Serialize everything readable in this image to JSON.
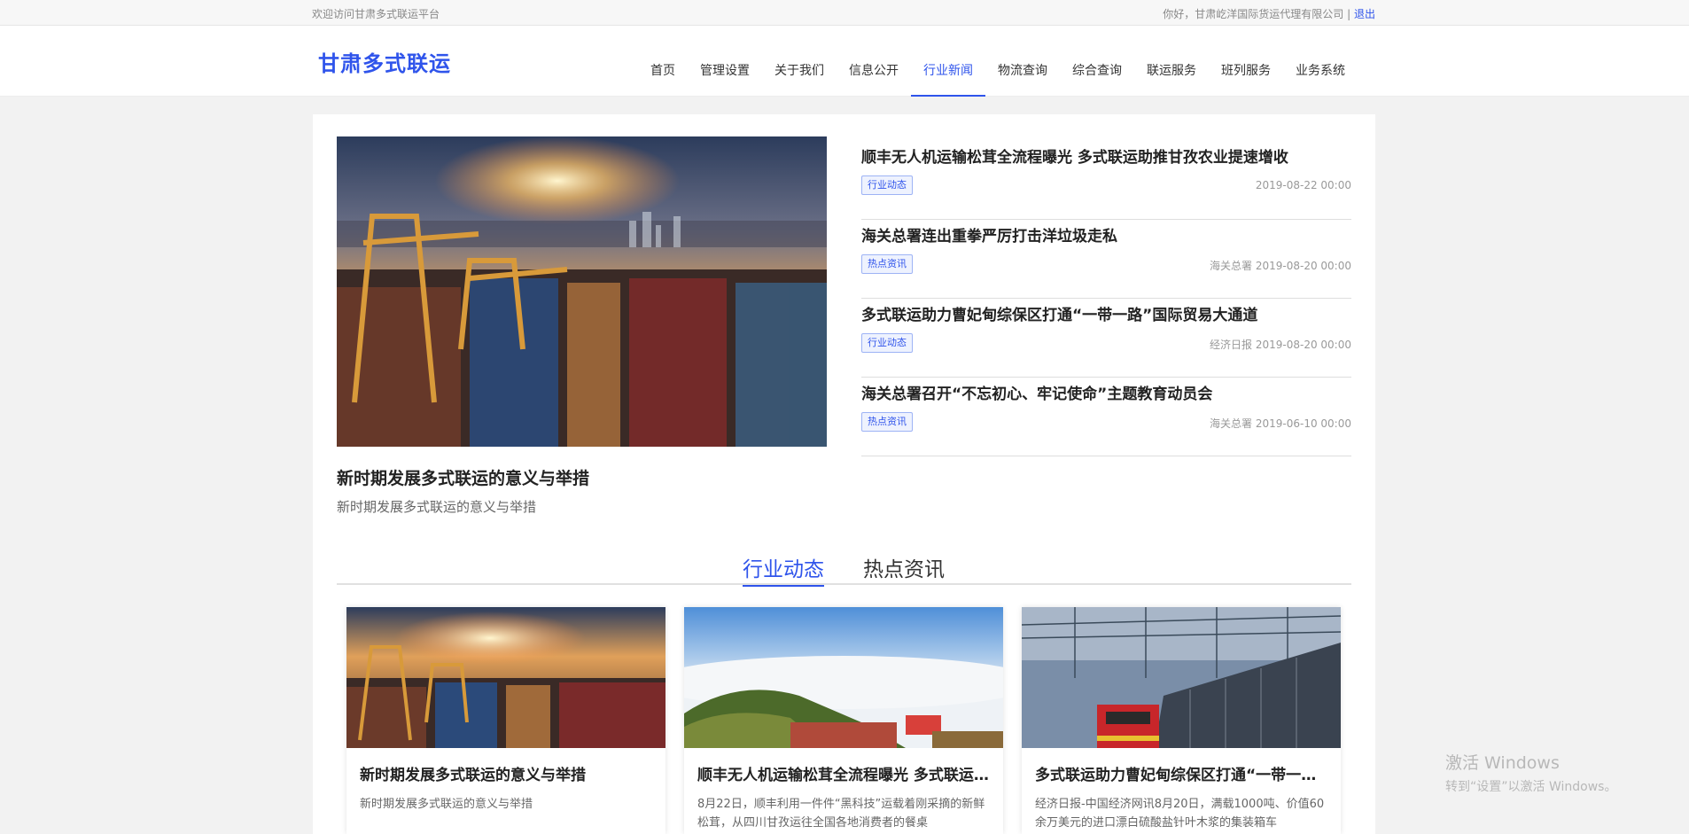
{
  "topbar": {
    "welcome": "欢迎访问甘肃多式联运平台",
    "greeting": "你好，甘肃屹洋国际货运代理有限公司",
    "separator": "|",
    "logout": "退出"
  },
  "header": {
    "logo": "甘肃多式联运",
    "nav": [
      {
        "label": "首页"
      },
      {
        "label": "管理设置"
      },
      {
        "label": "关于我们"
      },
      {
        "label": "信息公开"
      },
      {
        "label": "行业新闻"
      },
      {
        "label": "物流查询"
      },
      {
        "label": "综合查询"
      },
      {
        "label": "联运服务"
      },
      {
        "label": "班列服务"
      },
      {
        "label": "业务系统"
      }
    ],
    "active_nav": "行业新闻"
  },
  "hero": {
    "title": "新时期发展多式联运的意义与举措",
    "subtitle": "新时期发展多式联运的意义与举措"
  },
  "news": [
    {
      "title": "顺丰无人机运输松茸全流程曝光 多式联运助推甘孜农业提速增收",
      "tag": "行业动态",
      "meta": "2019-08-22 00:00"
    },
    {
      "title": "海关总署连出重拳严厉打击洋垃圾走私",
      "tag": "热点资讯",
      "meta": "海关总署 2019-08-20 00:00"
    },
    {
      "title": "多式联运助力曹妃甸综保区打通“一带一路”国际贸易大通道",
      "tag": "行业动态",
      "meta": "经济日报 2019-08-20 00:00"
    },
    {
      "title": "海关总署召开“不忘初心、牢记使命”主题教育动员会",
      "tag": "热点资讯",
      "meta": "海关总署 2019-06-10 00:00"
    }
  ],
  "tabs": [
    {
      "label": "行业动态"
    },
    {
      "label": "热点资讯"
    }
  ],
  "cards": [
    {
      "title": "新时期发展多式联运的意义与举措",
      "desc": "新时期发展多式联运的意义与举措"
    },
    {
      "title": "顺丰无人机运输松茸全流程曝光 多式联运助推甘孜农业提速增收",
      "desc": "8月22日，顺丰利用一件件“黑科技”运载着刚采摘的新鲜松茸，从四川甘孜运往全国各地消费者的餐桌"
    },
    {
      "title": "多式联运助力曹妃甸综保区打通“一带一路”国际贸易大通道",
      "desc": "经济日报-中国经济网讯8月20日，满载1000吨、价值60余万美元的进口漂白硫酸盐针叶木浆的集装箱车"
    }
  ],
  "watermark": {
    "line1": "激活 Windows",
    "line2": "转到“设置”以激活 Windows。"
  },
  "colors": {
    "accent": "#2f54eb",
    "background": "#f2f2f2"
  }
}
